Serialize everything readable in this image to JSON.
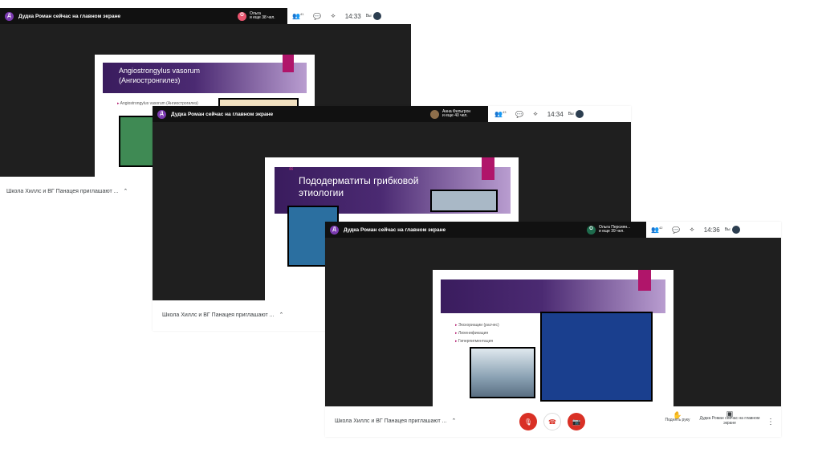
{
  "windows": [
    {
      "avatar_letter": "Д",
      "presenting": "Дудка Роман сейчас на главном экране",
      "participant_avatar": "О",
      "participant_name": "Ольга",
      "participant_more": "и еще 38 чел.",
      "participants_count": "41",
      "time": "14:33",
      "self_label": "Вы",
      "slide_title": "Angiostrongylus vasorum (Ангиостронгилез)",
      "slide_bullet": "Angiostrongylus vasorum (Ангиострогилез)",
      "footer": "Школа Хиллс и ВГ Панацея приглашают ..."
    },
    {
      "avatar_letter": "Д",
      "presenting": "Дудка Роман сейчас на главном экране",
      "participant_name": "Анна Фельгрон",
      "participant_more": "и еще 40 чел.",
      "participants_count": "43",
      "time": "14:34",
      "self_label": "Вы",
      "slide_quote": "“",
      "slide_title": "Пододерматиты грибковой этиологии",
      "footer": "Школа Хиллс и ВГ Панацея приглашают ..."
    },
    {
      "avatar_letter": "Д",
      "presenting": "Дудка Роман сейчас на главном экране",
      "participant_avatar": "О",
      "participant_name": "Ольга Персиян...",
      "participant_more": "и еще 39 чел.",
      "participants_count": "42",
      "time": "14:36",
      "self_label": "Вы",
      "bullets": [
        "Экскориации (расчес)",
        "Лихенификация",
        "Гиперпигментация"
      ],
      "footer": "Школа Хиллс и ВГ Панацея приглашают ...",
      "raise_hand": "Поднять руку",
      "presenter_label": "Дудка Роман сейчас на главном экране"
    }
  ],
  "icons": {
    "people": "👥",
    "chat": "💬",
    "activities": "⟡",
    "chevron": "⌃",
    "mic_off": "🎙",
    "hangup": "☎",
    "cam_off": "📷",
    "hand": "✋",
    "present": "▣",
    "more": "⋮"
  },
  "colors": {
    "accent_purple": "#7b3ab0",
    "magenta": "#b0156a",
    "danger_red": "#d93025",
    "bar": "#111111"
  }
}
